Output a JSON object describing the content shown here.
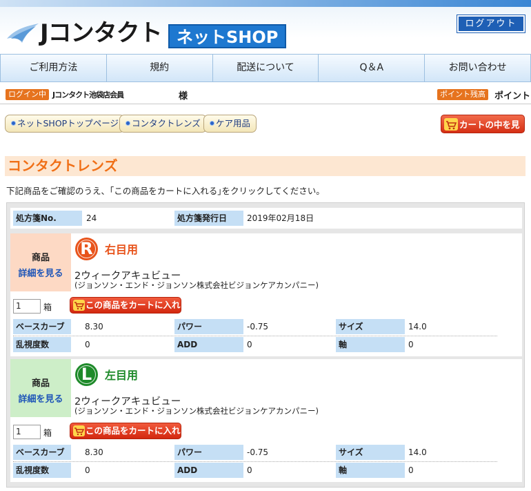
{
  "header": {
    "logo_text": "Jコンタクト",
    "logo_badge": "ネットSHOP",
    "logout_label": "ログアウト"
  },
  "nav": {
    "items": [
      "ご利用方法",
      "規約",
      "配送について",
      "Q＆A",
      "お問い合わせ"
    ]
  },
  "login": {
    "badge": "ログイン中",
    "store_member": "Jコンタクト池袋店会員",
    "sama": "様",
    "points_badge": "ポイント残高",
    "points_label": "ポイント"
  },
  "subnav": {
    "items": [
      "ネットSHOPトップページ",
      "コンタクトレンズ",
      "ケア用品"
    ],
    "cart_view": "カートの中を見る"
  },
  "section": {
    "title": "コンタクトレンズ",
    "instruction": "下記商品をご確認のうえ、｢この商品をカートに入れる｣をクリックしてください。"
  },
  "prescription": {
    "no_label": "処方箋No.",
    "no_value": "24",
    "date_label": "処方箋発行日",
    "date_value": "2019年02月18日"
  },
  "products": [
    {
      "side_label": "商品",
      "detail_link": "詳細を見る",
      "eye_letter": "R",
      "eye_label": "右目用",
      "eye_color": "#e8541c",
      "side_bg": "#fdd9c4",
      "name": "2ウィークアキュビュー",
      "maker": "(ジョンソン・エンド・ジョンソン株式会社ビジョンケアカンパニー)",
      "qty": "1",
      "qty_unit": "箱",
      "add_button": "この商品をカートに入れる",
      "specs": {
        "bc_label": "ベースカーブ",
        "bc_value": "8.30",
        "power_label": "パワー",
        "power_value": "-0.75",
        "size_label": "サイズ",
        "size_value": "14.0",
        "cyl_label": "乱視度数",
        "cyl_value": "0",
        "add_label": "ADD",
        "add_value": "0",
        "axis_label": "軸",
        "axis_value": "0"
      }
    },
    {
      "side_label": "商品",
      "detail_link": "詳細を見る",
      "eye_letter": "L",
      "eye_label": "左目用",
      "eye_color": "#1e8a2a",
      "side_bg": "#cdeec8",
      "name": "2ウィークアキュビュー",
      "maker": "(ジョンソン・エンド・ジョンソン株式会社ビジョンケアカンパニー)",
      "qty": "1",
      "qty_unit": "箱",
      "add_button": "この商品をカートに入れる",
      "specs": {
        "bc_label": "ベースカーブ",
        "bc_value": "8.30",
        "power_label": "パワー",
        "power_value": "-0.75",
        "size_label": "サイズ",
        "size_value": "14.0",
        "cyl_label": "乱視度数",
        "cyl_value": "0",
        "add_label": "ADD",
        "add_value": "0",
        "axis_label": "軸",
        "axis_value": "0"
      }
    }
  ]
}
